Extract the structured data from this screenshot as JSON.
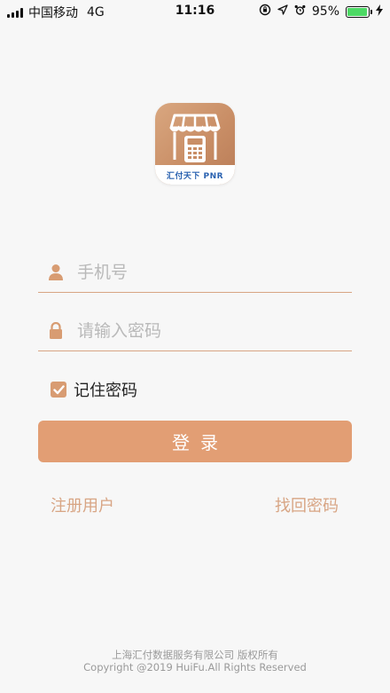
{
  "status_bar": {
    "carrier": "中国移动",
    "network": "4G",
    "time": "11:16",
    "battery_percent": "95%",
    "battery_level": 0.95,
    "battery_color": "#4cd964"
  },
  "logo": {
    "band_text": "汇付天下 PNR"
  },
  "form": {
    "phone_placeholder": "手机号",
    "password_placeholder": "请输入密码",
    "remember_label": "记住密码",
    "remember_checked": true,
    "login_label": "登录"
  },
  "links": {
    "register": "注册用户",
    "forgot": "找回密码"
  },
  "footer": {
    "line1": "上海汇付数据服务有限公司 版权所有",
    "line2": "Copyright @2019 HuiFu.All Rights Reserved"
  },
  "colors": {
    "accent": "#e29e74",
    "accent_text": "#d8a584",
    "background": "#f7f7f7"
  },
  "icons": {
    "phone_field": "user-icon",
    "password_field": "lock-icon",
    "status": [
      "portrait-lock-icon",
      "location-arrow-icon",
      "alarm-icon",
      "charging-icon"
    ]
  }
}
